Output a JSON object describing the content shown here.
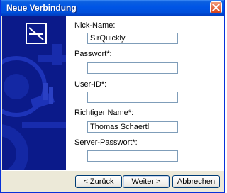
{
  "window": {
    "title": "Neue Verbindung"
  },
  "form": {
    "fields": [
      {
        "label": "Nick-Name:",
        "value": "SirQuickly"
      },
      {
        "label": "Passwort*:",
        "value": ""
      },
      {
        "label": "User-ID*:",
        "value": ""
      },
      {
        "label": "Richtiger Name*:",
        "value": "Thomas Schaertl"
      },
      {
        "label": "Server-Passwort*:",
        "value": ""
      }
    ]
  },
  "buttons": {
    "back": "< Zurück",
    "next": "Weiter >",
    "cancel": "Abbrechen"
  },
  "colors": {
    "title_bar": "#0055e5",
    "side_panel": "#0b1a8a",
    "input_border": "#7f9db9"
  },
  "icons": [
    "close-icon",
    "wizard-logo-icon"
  ]
}
